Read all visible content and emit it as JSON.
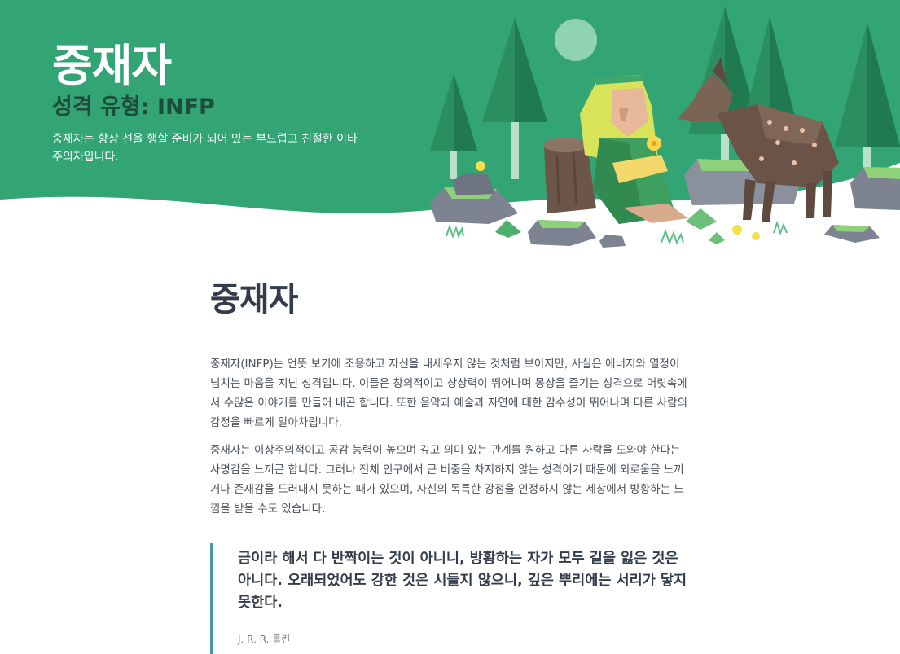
{
  "hero": {
    "title": "중재자",
    "subtitle": "성격 유형: INFP",
    "description": "중재자는 항상 선을 행할 준비가 되어 있는 부드럽고 친절한 이타주의자입니다."
  },
  "article": {
    "title": "중재자",
    "paragraphs": [
      "중재자(INFP)는 언뜻 보기에 조용하고 자신을 내세우지 않는 것처럼 보이지만, 사실은 에너지와 열정이 넘치는 마음을 지닌 성격입니다. 이들은 창의적이고 상상력이 뛰어나며 몽상을 즐기는 성격으로 머릿속에서 수많은 이야기를 만들어 내곤 합니다. 또한 음악과 예술과 자연에 대한 감수성이 뛰어나며 다른 사람의 감정을 빠르게 알아차립니다.",
      "중재자는 이상주의적이고 공감 능력이 높으며 깊고 의미 있는 관계를 원하고 다른 사람을 도와야 한다는 사명감을 느끼곤 합니다. 그러나 전체 인구에서 큰 비중을 차지하지 않는 성격이기 때문에 외로움을 느끼거나 존재감을 드러내지 못하는 때가 있으며, 자신의 독특한 강점을 인정하지 않는 세상에서 방황하는 느낌을 받을 수도 있습니다."
    ],
    "quote": {
      "text": "금이라 해서 다 반짝이는 것이 아니니, 방황하는 자가 모두 길을 잃은 것은 아니다. 오래되었어도 강한 것은 시들지 않으니, 깊은 뿌리에는 서리가 닿지 못한다.",
      "author": "J. R. R. 톨킨"
    }
  },
  "colors": {
    "hero_green": "#33a474",
    "dark_green": "#1d4d3a",
    "quote_border": "#4a95a8"
  },
  "illustration": {
    "icon": "mediator-forest-illustration"
  }
}
